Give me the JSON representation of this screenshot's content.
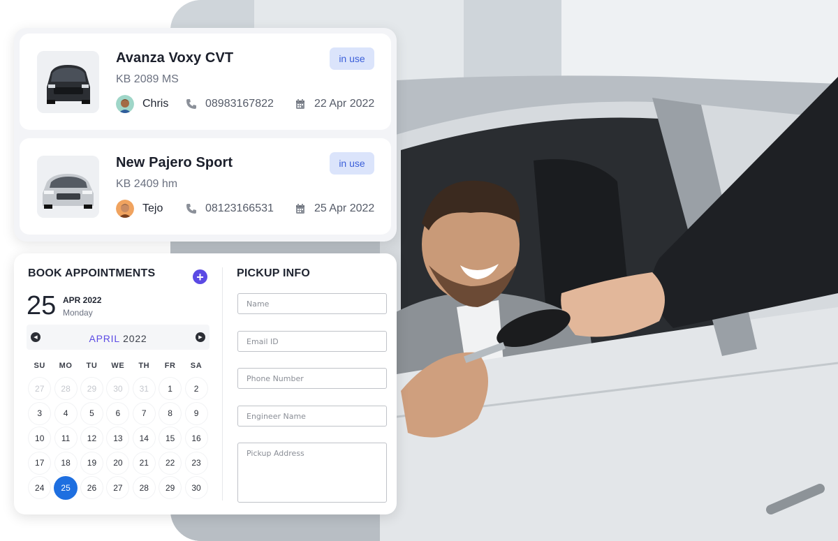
{
  "vehicles": [
    {
      "name": "Avanza Voxy CVT",
      "plate": "KB 2089 MS",
      "status": "in use",
      "driver": "Chris",
      "phone": "08983167822",
      "date": "22 Apr 2022",
      "car_color": "#2b2e33"
    },
    {
      "name": "New Pajero Sport",
      "plate": "KB 2409 hm",
      "status": "in use",
      "driver": "Tejo",
      "phone": "08123166531",
      "date": "25 Apr 2022",
      "car_color": "#c5c9ce"
    }
  ],
  "booking": {
    "title": "BOOK APPOINTMENTS",
    "add_icon": "plus-circle-icon",
    "selected_day": "25",
    "selected_month_year": "APR 2022",
    "selected_weekday": "Monday",
    "calendar": {
      "month": "APRIL",
      "year": "2022",
      "weekdays": [
        "SU",
        "MO",
        "TU",
        "WE",
        "TH",
        "FR",
        "SA"
      ],
      "days": [
        {
          "d": "27",
          "muted": true
        },
        {
          "d": "28",
          "muted": true
        },
        {
          "d": "29",
          "muted": true
        },
        {
          "d": "30",
          "muted": true
        },
        {
          "d": "31",
          "muted": true
        },
        {
          "d": "1"
        },
        {
          "d": "2"
        },
        {
          "d": "3"
        },
        {
          "d": "4"
        },
        {
          "d": "5"
        },
        {
          "d": "6"
        },
        {
          "d": "7"
        },
        {
          "d": "8"
        },
        {
          "d": "9"
        },
        {
          "d": "10"
        },
        {
          "d": "11"
        },
        {
          "d": "12"
        },
        {
          "d": "13"
        },
        {
          "d": "14"
        },
        {
          "d": "15"
        },
        {
          "d": "16"
        },
        {
          "d": "17"
        },
        {
          "d": "18"
        },
        {
          "d": "19"
        },
        {
          "d": "20"
        },
        {
          "d": "21"
        },
        {
          "d": "22"
        },
        {
          "d": "23"
        },
        {
          "d": "24"
        },
        {
          "d": "25",
          "selected": true
        },
        {
          "d": "26"
        },
        {
          "d": "27"
        },
        {
          "d": "28"
        },
        {
          "d": "29"
        },
        {
          "d": "30"
        }
      ]
    }
  },
  "pickup": {
    "title": "PICKUP INFO",
    "name_placeholder": "Name",
    "email_placeholder": "Email ID",
    "phone_placeholder": "Phone Number",
    "engineer_placeholder": "Engineer Name",
    "address_placeholder": "Pickup Address"
  },
  "colors": {
    "accent": "#5b4ae4",
    "selected_day": "#1e6fe0",
    "badge_bg": "#dbe4fb",
    "badge_text": "#3b5fd9"
  }
}
